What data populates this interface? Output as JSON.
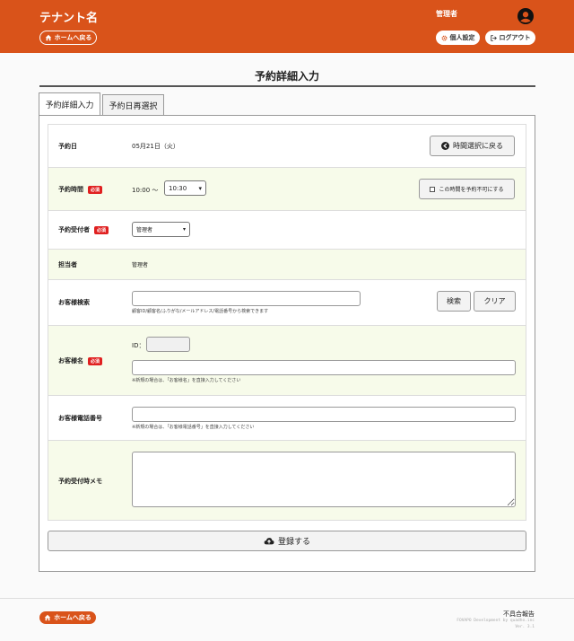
{
  "header": {
    "tenant_name": "テナント名",
    "home_button": "ホームへ戻る",
    "admin_name": "管理者",
    "personal_settings": "個人設定",
    "logout": "ログアウト"
  },
  "page": {
    "title": "予約詳細入力"
  },
  "tabs": [
    {
      "label": "予約詳細入力",
      "active": true
    },
    {
      "label": "予約日再選択",
      "active": false
    }
  ],
  "form": {
    "required_badge": "必須",
    "date": {
      "label": "予約日",
      "value": "05月21日（火）",
      "back_button": "時間選択に戻る"
    },
    "time": {
      "label": "予約時間",
      "start": "10:00",
      "separator": "〜",
      "end": "10:30",
      "unavailable_button": "この時間を予約不可にする"
    },
    "receptionist": {
      "label": "予約受付者",
      "value": "管理者"
    },
    "staff": {
      "label": "担当者",
      "value": "管理者"
    },
    "customer_search": {
      "label": "お客様検索",
      "value": "",
      "hint": "顧客ID/顧客名/ふりがな/メールアドレス/電話番号から検索できます",
      "search_button": "検索",
      "clear_button": "クリア"
    },
    "customer_name": {
      "label": "お客様名",
      "id_label": "ID：",
      "id_value": "",
      "value": "",
      "hint": "※新規の場合は、「お客様名」を直接入力してください"
    },
    "customer_phone": {
      "label": "お客様電話番号",
      "value": "",
      "hint": "※新規の場合は、「お客様電話番号」を直接入力してください"
    },
    "memo": {
      "label": "予約受付時メモ",
      "value": ""
    },
    "submit_button": "登録する"
  },
  "footer": {
    "home_button": "ホームへ戻る",
    "report_link": "不具合報告",
    "credit": "FOVAPO Development by quadho.inc",
    "version": "Ver. 3.1"
  },
  "colors": {
    "brand": "#d9531a",
    "row_highlight": "#f7fbea",
    "required": "#e02020"
  }
}
